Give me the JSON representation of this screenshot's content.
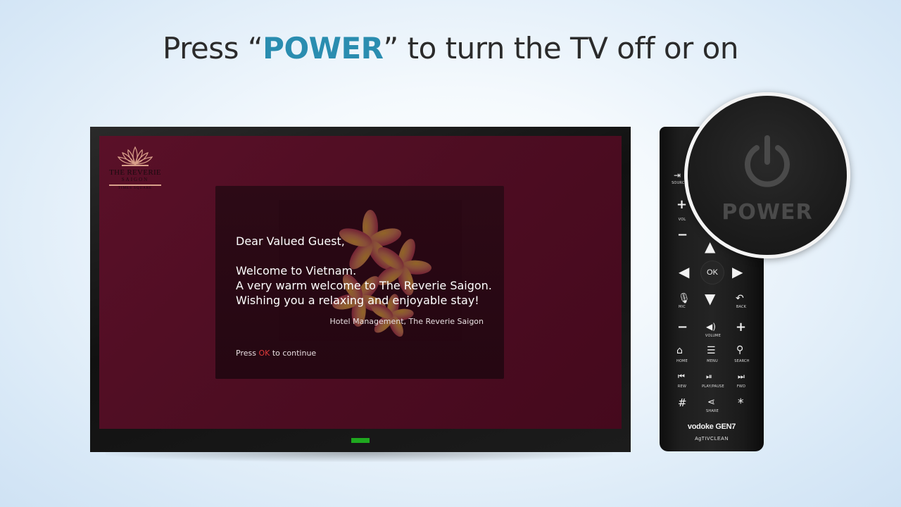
{
  "headline": {
    "prefix": "Press “",
    "keyword": "POWER",
    "suffix": "” to turn the TV off or on"
  },
  "logo": {
    "title": "THE REVERIE",
    "sub": "SAIGON",
    "tagline": "TIMES SQUARE"
  },
  "dialog": {
    "line1": "Dear Valued Guest,",
    "line2": "Welcome to Vietnam.",
    "line3": "A very warm welcome to The Reverie Saigon.",
    "line4": "Wishing you a relaxing and enjoyable stay!",
    "signature": "Hotel Management, The Reverie Saigon",
    "continue_prefix": "Press ",
    "continue_key": "OK",
    "continue_suffix": " to continue"
  },
  "remote": {
    "source": "SOURCE",
    "vol": "VOL",
    "ok": "OK",
    "mic": "MIC",
    "back": "BACK",
    "volume": "VOLUME",
    "home": "HOME",
    "menu": "MENU",
    "search": "SEARCH",
    "rew": "REW",
    "play_pause": "PLAY/PAUSE",
    "fwd": "FWD",
    "share": "SHARE",
    "hash": "#",
    "star": "*",
    "brand": "vodoke GEN7",
    "brand_sub": "AgTIVCLEAN"
  },
  "zoom": {
    "label": "POWER"
  },
  "colors": {
    "accent": "#2a8db0",
    "screen": "#4d0d22",
    "led": "#1fa81f",
    "ok_highlight": "#e03a3a"
  }
}
